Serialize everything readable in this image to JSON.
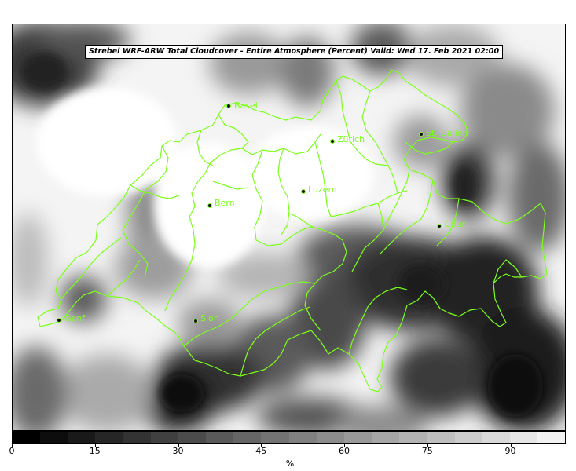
{
  "title": "Strebel WRF-ARW Total Cloudcover - Entire Atmosphere (Percent)   Valid: Wed 17. Feb 2021 02:00",
  "cities": [
    {
      "name": "Basel"
    },
    {
      "name": "Zürich"
    },
    {
      "name": "St. Gallen"
    },
    {
      "name": "Luzern"
    },
    {
      "name": "Bern"
    },
    {
      "name": "Chur"
    },
    {
      "name": "Genf"
    },
    {
      "name": "Sion"
    }
  ],
  "colorbar": {
    "ticks": [
      "0",
      "15",
      "30",
      "45",
      "60",
      "75",
      "90"
    ],
    "unit": "%",
    "colors": [
      "#000000",
      "#0d0d0d",
      "#191919",
      "#262626",
      "#333333",
      "#404040",
      "#4c4c4c",
      "#595959",
      "#666666",
      "#737373",
      "#808080",
      "#8c8c8c",
      "#999999",
      "#a6a6a6",
      "#b3b3b3",
      "#bfbfbf",
      "#cccccc",
      "#d9d9d9",
      "#e6e6e6",
      "#f2f2f2"
    ]
  },
  "colors": {
    "border_lines": "#7cff1a",
    "labels": "#7cff1a"
  }
}
